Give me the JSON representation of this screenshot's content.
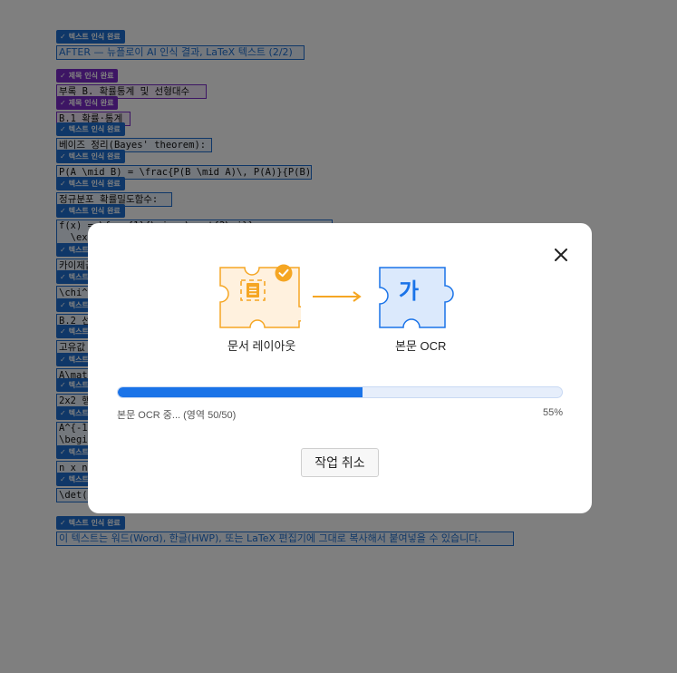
{
  "document": {
    "blocks": [
      {
        "tag_type": "text",
        "tag": "텍스트 인식 완료",
        "text": "AFTER — 뉴플로이 AI 인식 결과, LaTeX 텍스트 (2/2)",
        "style": "plain"
      },
      {
        "tag_type": "title",
        "tag": "제목 인식 완료",
        "text": "부록 B. 확률통계 및 선형대수",
        "style": "mono"
      },
      {
        "tag_type": "title",
        "tag": "제목 인식 완료",
        "text": "B.1 확률·통계",
        "style": "mono"
      },
      {
        "tag_type": "text",
        "tag": "텍스트 인식 완료",
        "text": "베이즈 정리(Bayes' theorem):",
        "style": "mono"
      },
      {
        "tag_type": "text",
        "tag": "텍스트 인식 완료",
        "text": "P(A \\mid B) = \\frac{P(B \\mid A)\\, P(A)}{P(B)}",
        "style": "mono"
      },
      {
        "tag_type": "text",
        "tag": "텍스트 인식 완료",
        "text": "정규분포 확률밀도함수:",
        "style": "mono"
      },
      {
        "tag_type": "text",
        "tag": "텍스트 인식 완료",
        "text": "f(x) = \\frac{1}{\\sigma\\sqrt{2\\pi}}\n  \\exp\\left(-\\frac{(x-\\mu)^2}{2\\sigma^2}\\right)",
        "style": "mono"
      },
      {
        "tag_type": "text",
        "tag": "텍스트 인식 완료",
        "text": "카이제곱 통계량:",
        "style": "mono"
      },
      {
        "tag_type": "text",
        "tag": "텍스트 인식 완료",
        "text": "\\chi^2 = \\sum \\frac{(O-E)^2}{E}",
        "style": "mono"
      },
      {
        "tag_type": "text",
        "tag": "텍스트 인식 완료",
        "text": "B.2 선형대수",
        "style": "mono"
      },
      {
        "tag_type": "text",
        "tag": "텍스트 인식 완료",
        "text": "고유값 방정식:",
        "style": "mono"
      },
      {
        "tag_type": "text",
        "tag": "텍스트 인식 완료",
        "text": "A\\mathbf{v} = \\lambda\\mathbf{v}",
        "style": "mono"
      },
      {
        "tag_type": "text",
        "tag": "텍스트 인식 완료",
        "text": "2x2 행렬의 역행렬:",
        "style": "mono"
      },
      {
        "tag_type": "text",
        "tag": "텍스트 인식 완료",
        "text": "A^{-1} = \\frac{1}{ad-bc}\n\\begin{pmatrix} d & -b \\\\ -c & a \\end{pmatrix}",
        "style": "mono"
      },
      {
        "tag_type": "text",
        "tag": "텍스트 인식 완료",
        "text": "n x n 행렬식:",
        "style": "mono"
      },
      {
        "tag_type": "text",
        "tag": "텍스트 인식 완료",
        "text": "\\det(A) = \\sum_{j} a_{ij} C_{ij}",
        "style": "mono"
      },
      {
        "tag_type": "text",
        "tag": "텍스트 인식 완료",
        "text": "이 텍스트는 워드(Word), 한글(HWP), 또는 LaTeX 편집기에 그대로 복사해서 붙여넣을 수 있습니다.",
        "style": "plain"
      }
    ]
  },
  "modal": {
    "close_icon": "close-icon",
    "steps": [
      {
        "label": "문서 레이아웃",
        "icon": "layout-puzzle-icon",
        "status": "done",
        "color": "#f5a623"
      },
      {
        "label": "본문 OCR",
        "icon": "ocr-puzzle-icon",
        "glyph": "가",
        "status": "active",
        "color": "#1a73e8"
      }
    ],
    "progress": {
      "percent": 55,
      "percent_label": "55%",
      "status_text": "본문 OCR 중... (영역 50/50)"
    },
    "cancel_label": "작업 취소"
  },
  "colors": {
    "accent": "#1a73e8",
    "done": "#f5a623",
    "tag_text": "#1e6fd0",
    "tag_title": "#7b2bc9"
  }
}
